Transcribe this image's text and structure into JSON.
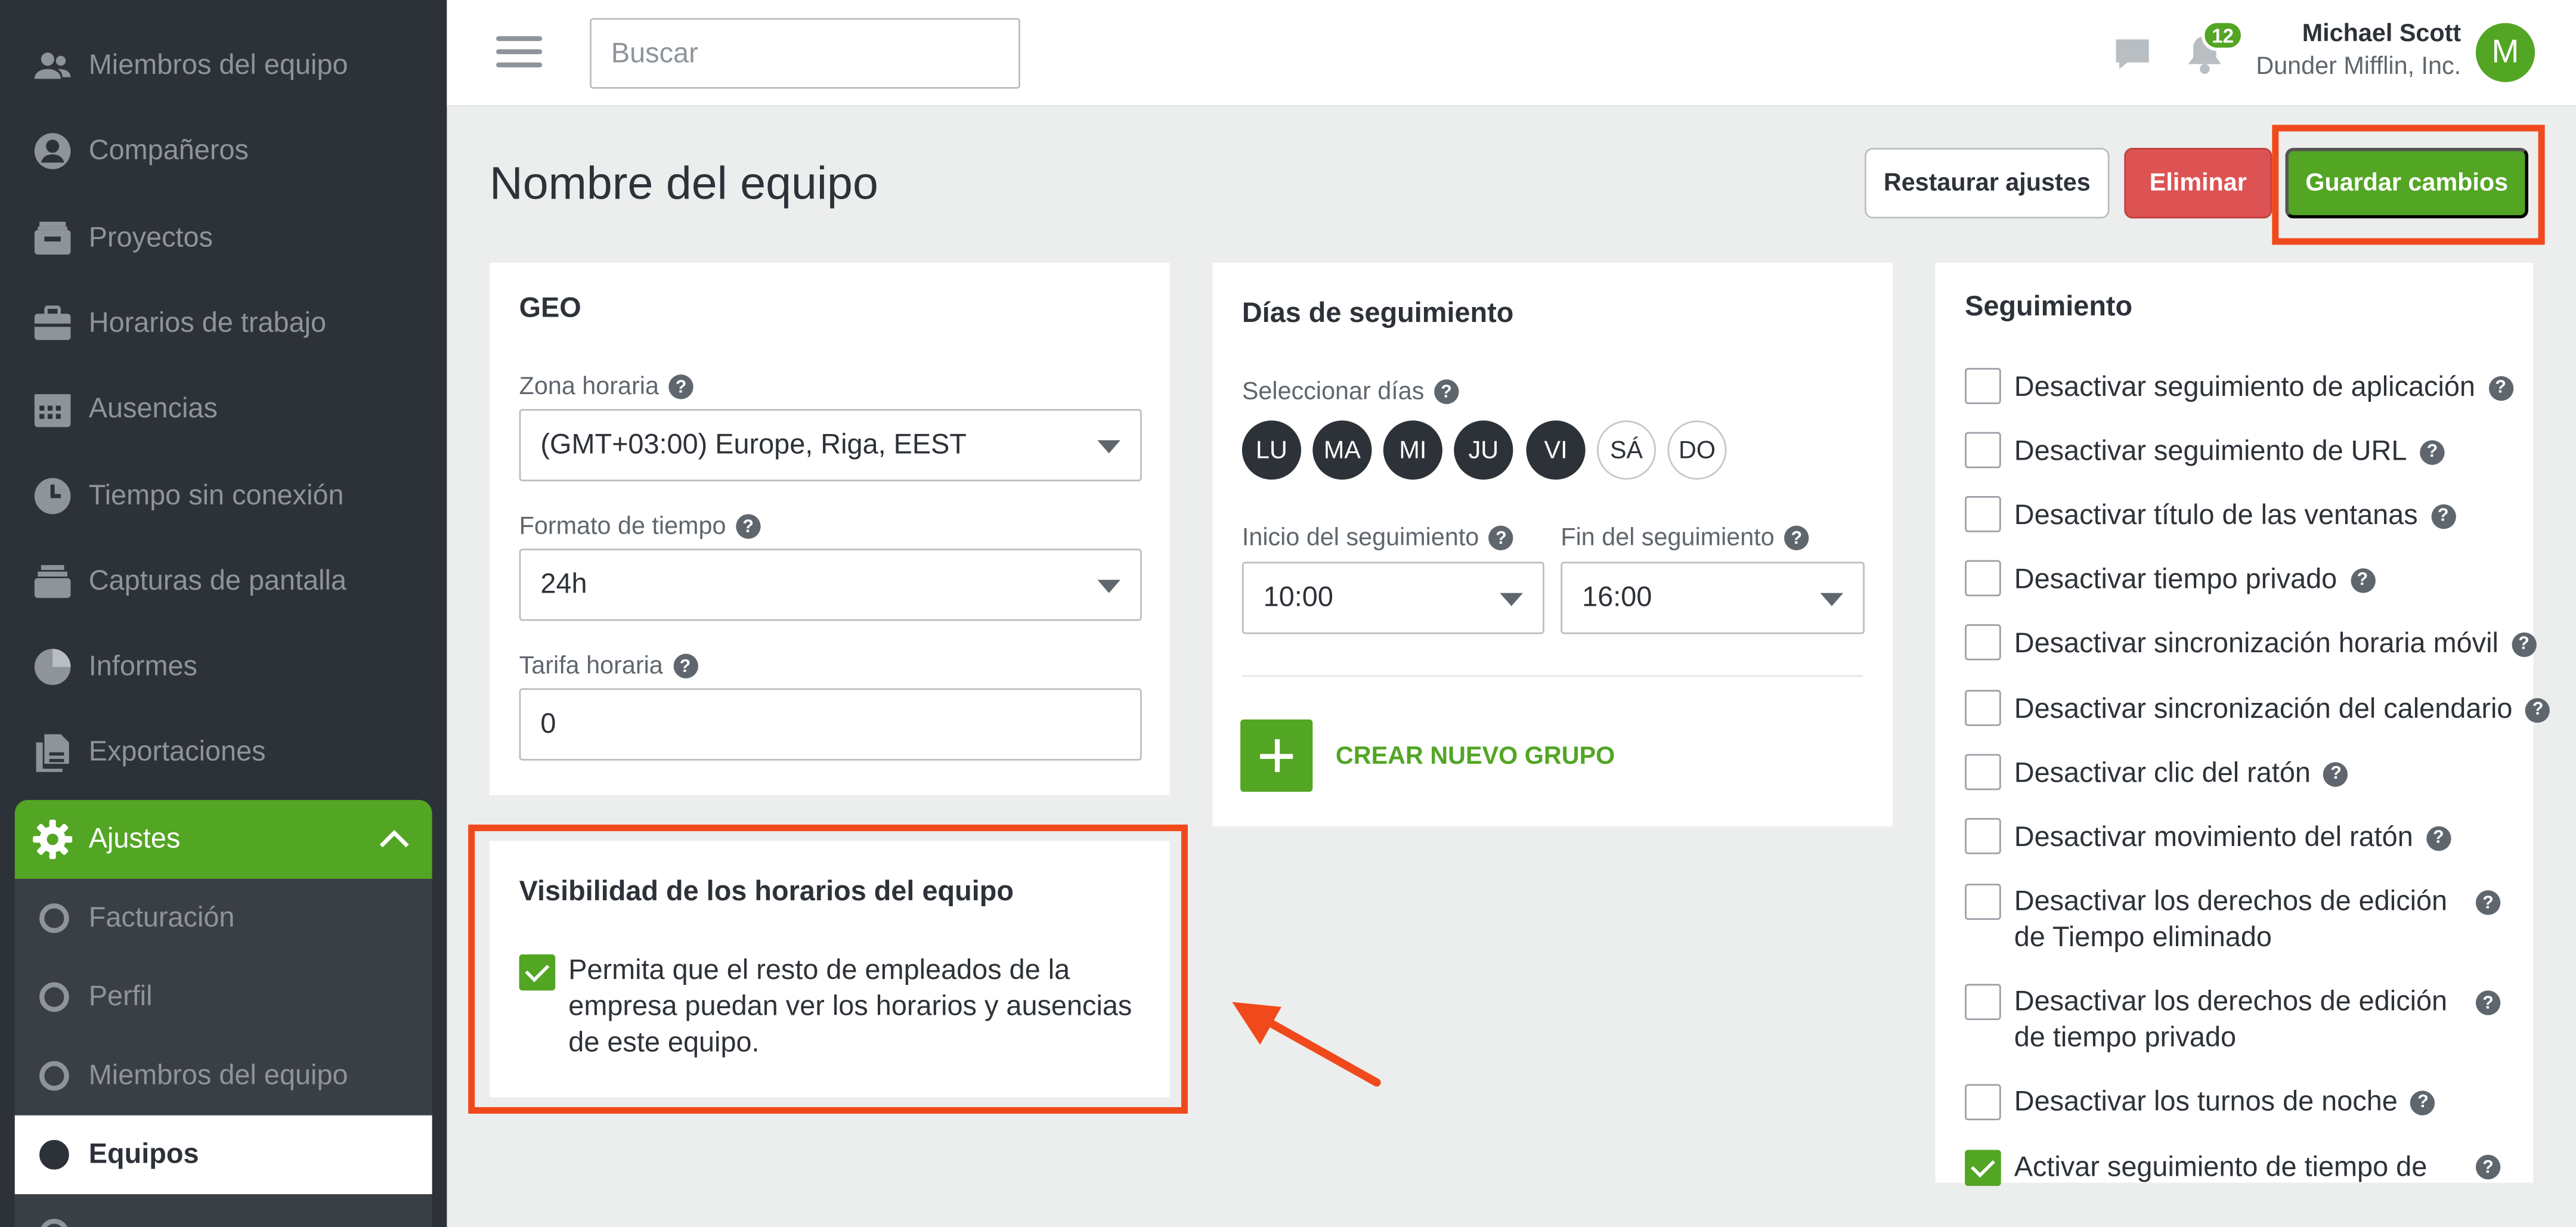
{
  "sidebar": {
    "items": [
      {
        "label": "Miembros del equipo",
        "icon": "users-icon"
      },
      {
        "label": "Compañeros",
        "icon": "user-circle-icon"
      },
      {
        "label": "Proyectos",
        "icon": "inbox-icon"
      },
      {
        "label": "Horarios de trabajo",
        "icon": "briefcase-icon"
      },
      {
        "label": "Ausencias",
        "icon": "calendar-icon"
      },
      {
        "label": "Tiempo sin conexión",
        "icon": "clock-icon"
      },
      {
        "label": "Capturas de pantalla",
        "icon": "stack-icon"
      },
      {
        "label": "Informes",
        "icon": "pie-chart-icon"
      },
      {
        "label": "Exportaciones",
        "icon": "files-icon"
      }
    ],
    "active": {
      "label": "Ajustes",
      "icon": "gear-icon"
    },
    "submenu": [
      {
        "label": "Facturación"
      },
      {
        "label": "Perfil"
      },
      {
        "label": "Miembros del equipo"
      },
      {
        "label": "Equipos"
      }
    ]
  },
  "topbar": {
    "search_placeholder": "Buscar",
    "notifications_count": "12",
    "user_name": "Michael Scott",
    "user_company": "Dunder Mifflin, Inc.",
    "avatar_letter": "M"
  },
  "header": {
    "title": "Nombre del equipo",
    "reset_label": "Restaurar ajustes",
    "delete_label": "Eliminar",
    "save_label": "Guardar cambios"
  },
  "geo": {
    "title": "GEO",
    "timezone_label": "Zona horaria",
    "timezone_value": "(GMT+03:00) Europe, Riga, EEST",
    "timeformat_label": "Formato de tiempo",
    "timeformat_value": "24h",
    "rate_label": "Tarifa horaria",
    "rate_value": "0"
  },
  "tracking_days": {
    "title": "Días de seguimiento",
    "select_label": "Seleccionar días",
    "days": [
      {
        "label": "LU",
        "on": true
      },
      {
        "label": "MA",
        "on": true
      },
      {
        "label": "MI",
        "on": true
      },
      {
        "label": "JU",
        "on": true
      },
      {
        "label": "VI",
        "on": true
      },
      {
        "label": "SÁ",
        "on": false
      },
      {
        "label": "DO",
        "on": false
      }
    ],
    "start_label": "Inicio del seguimiento",
    "start_value": "10:00",
    "end_label": "Fin del seguimiento",
    "end_value": "16:00",
    "create_group_label": "CREAR NUEVO GRUPO"
  },
  "visibility": {
    "title": "Visibilidad de los horarios del equipo",
    "text": "Permita que el resto de empleados de la empresa puedan ver los horarios y ausencias de este equipo.",
    "checked": true
  },
  "tracking": {
    "title": "Seguimiento",
    "options": [
      {
        "label": "Desactivar seguimiento de aplicación",
        "checked": false
      },
      {
        "label": "Desactivar seguimiento de URL",
        "checked": false
      },
      {
        "label": "Desactivar título de las ventanas",
        "checked": false
      },
      {
        "label": "Desactivar tiempo privado",
        "checked": false
      },
      {
        "label": "Desactivar sincronización horaria móvil",
        "checked": false
      },
      {
        "label": "Desactivar sincronización del calendario",
        "checked": false
      },
      {
        "label": "Desactivar clic del ratón",
        "checked": false
      },
      {
        "label": "Desactivar movimiento del ratón",
        "checked": false
      },
      {
        "label": "Desactivar los derechos de edición de Tiempo eliminado",
        "checked": false
      },
      {
        "label": "Desactivar los derechos de edición de tiempo privado",
        "checked": false
      },
      {
        "label": "Desactivar los turnos de noche",
        "checked": false
      },
      {
        "label": "Activar seguimiento de tiempo de",
        "checked": true
      }
    ]
  },
  "colors": {
    "accent": "#53a524",
    "sidebar_bg": "#2d3238",
    "danger": "#dd5353",
    "highlight": "#f04a1c"
  }
}
